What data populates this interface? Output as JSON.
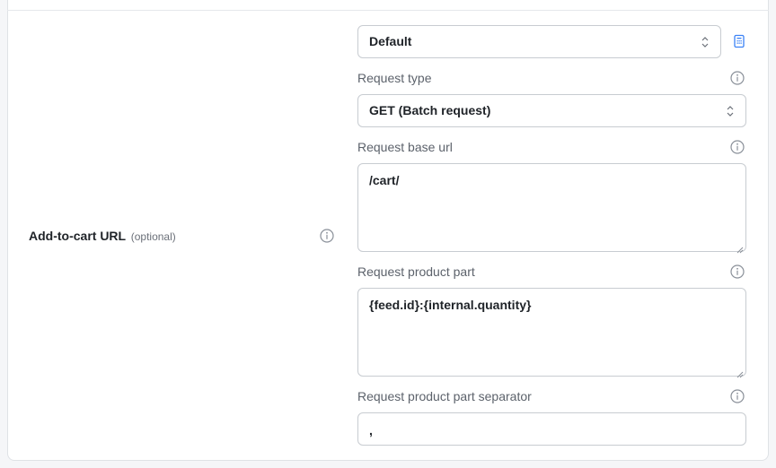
{
  "row": {
    "label": "Add-to-cart URL",
    "optional": "(optional)"
  },
  "preset_select": {
    "value": "Default"
  },
  "request_type": {
    "label": "Request type",
    "value": "GET (Batch request)"
  },
  "base_url": {
    "label": "Request base url",
    "value": "/cart/"
  },
  "product_part": {
    "label": "Request product part",
    "value": "{feed.id}:{internal.quantity}"
  },
  "separator": {
    "label": "Request product part separator",
    "value": ","
  },
  "colors": {
    "accent": "#3b82f6",
    "border": "#c8ccd1",
    "label": "#5c626b"
  }
}
